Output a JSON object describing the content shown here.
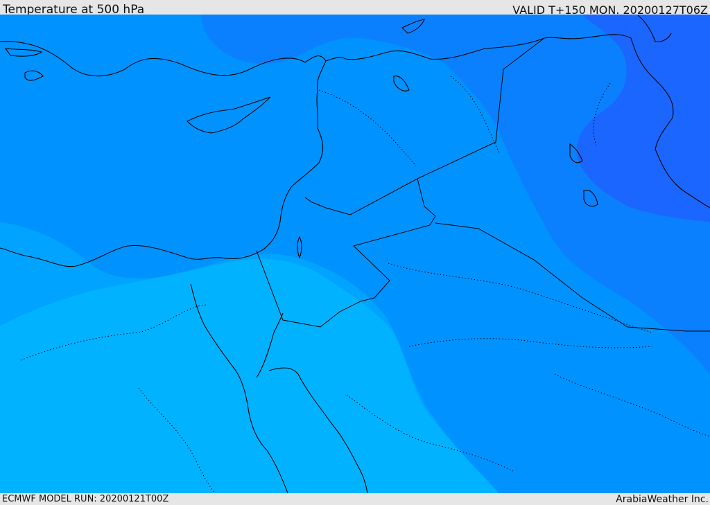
{
  "header": {
    "title": "Temperature at 500 hPa",
    "valid": "VALID T+150 MON. 20200127T06Z"
  },
  "footer": {
    "model_run": "ECMWF MODEL RUN: 20200121T00Z",
    "credit": "ArabiaWeather Inc."
  },
  "colors": {
    "band_coldest": "#1a66ff",
    "band_cold": "#0a80ff",
    "band_mid": "#0092ff",
    "band_warm": "#00a3ff",
    "band_warmer": "#00b2ff",
    "band_warmest": "#00c8ff",
    "boundary": "#000000"
  }
}
